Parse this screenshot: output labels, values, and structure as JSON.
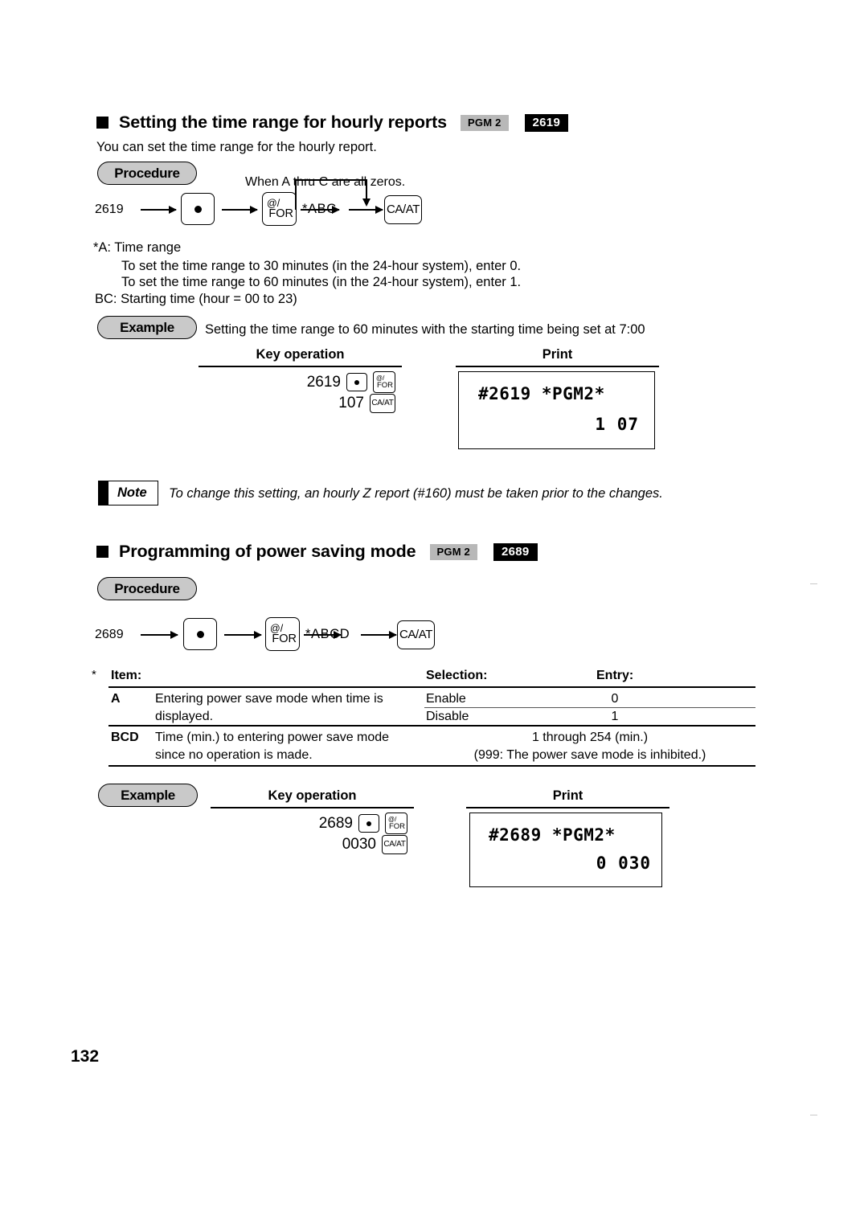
{
  "page": {
    "number": "132"
  },
  "sections": [
    {
      "title": "Setting the time range for hourly reports",
      "badge_mode": "PGM 2",
      "badge_code": "2619",
      "intro": "You can set the time range for the hourly report.",
      "procedure_label": "Procedure",
      "flow_note": "When A thru C are all zeros.",
      "flow": {
        "start": "2619",
        "key_dot": "•",
        "key_for_line1": "@/",
        "key_for_line2": "FOR",
        "param": "*ABC",
        "key_ca": "CA/AT"
      },
      "param_lines": [
        "*A:  Time range",
        "To set the time range to 30 minutes (in the 24-hour system), enter 0.",
        "To set the time range to 60 minutes (in the 24-hour system), enter 1.",
        "BC: Starting time (hour = 00 to 23)"
      ],
      "example_label": "Example",
      "example_text": "Setting the time range to 60 minutes with the starting time being set at 7:00",
      "keyop_header": "Key operation",
      "print_header": "Print",
      "keyop_rows": [
        {
          "value": "2619",
          "keys": [
            "dot",
            "for"
          ]
        },
        {
          "value": "107",
          "keys": [
            "ca"
          ]
        }
      ],
      "print": {
        "line1": "#2619 *PGM2*",
        "line2": "1  07"
      },
      "note_label": "Note",
      "note_text": "To change this setting, an hourly Z report (#160) must be taken prior to the changes."
    },
    {
      "title": "Programming of power saving mode",
      "badge_mode": "PGM 2",
      "badge_code": "2689",
      "procedure_label": "Procedure",
      "flow": {
        "start": "2689",
        "key_dot": "•",
        "key_for_line1": "@/",
        "key_for_line2": "FOR",
        "param": "*ABCD",
        "key_ca": "CA/AT"
      },
      "table": {
        "star": "*",
        "headers": {
          "item": "Item:",
          "selection": "Selection:",
          "entry": "Entry:"
        },
        "rows": [
          {
            "code": "A",
            "desc_line1": "Entering power save mode when time is",
            "desc_line2": "displayed.",
            "selections": [
              {
                "selection": "Enable",
                "entry": "0"
              },
              {
                "selection": "Disable",
                "entry": "1"
              }
            ]
          },
          {
            "code": "BCD",
            "desc_line1": "Time (min.) to entering power save mode",
            "desc_line2": "since no operation is made.",
            "span_line1": "1 through 254 (min.)",
            "span_line2": "(999: The power save mode is inhibited.)"
          }
        ]
      },
      "example_label": "Example",
      "keyop_header": "Key operation",
      "print_header": "Print",
      "keyop_rows": [
        {
          "value": "2689",
          "keys": [
            "dot",
            "for"
          ]
        },
        {
          "value": "0030",
          "keys": [
            "ca"
          ]
        }
      ],
      "print": {
        "line1": "#2689 *PGM2*",
        "line2": "0  030"
      }
    }
  ]
}
